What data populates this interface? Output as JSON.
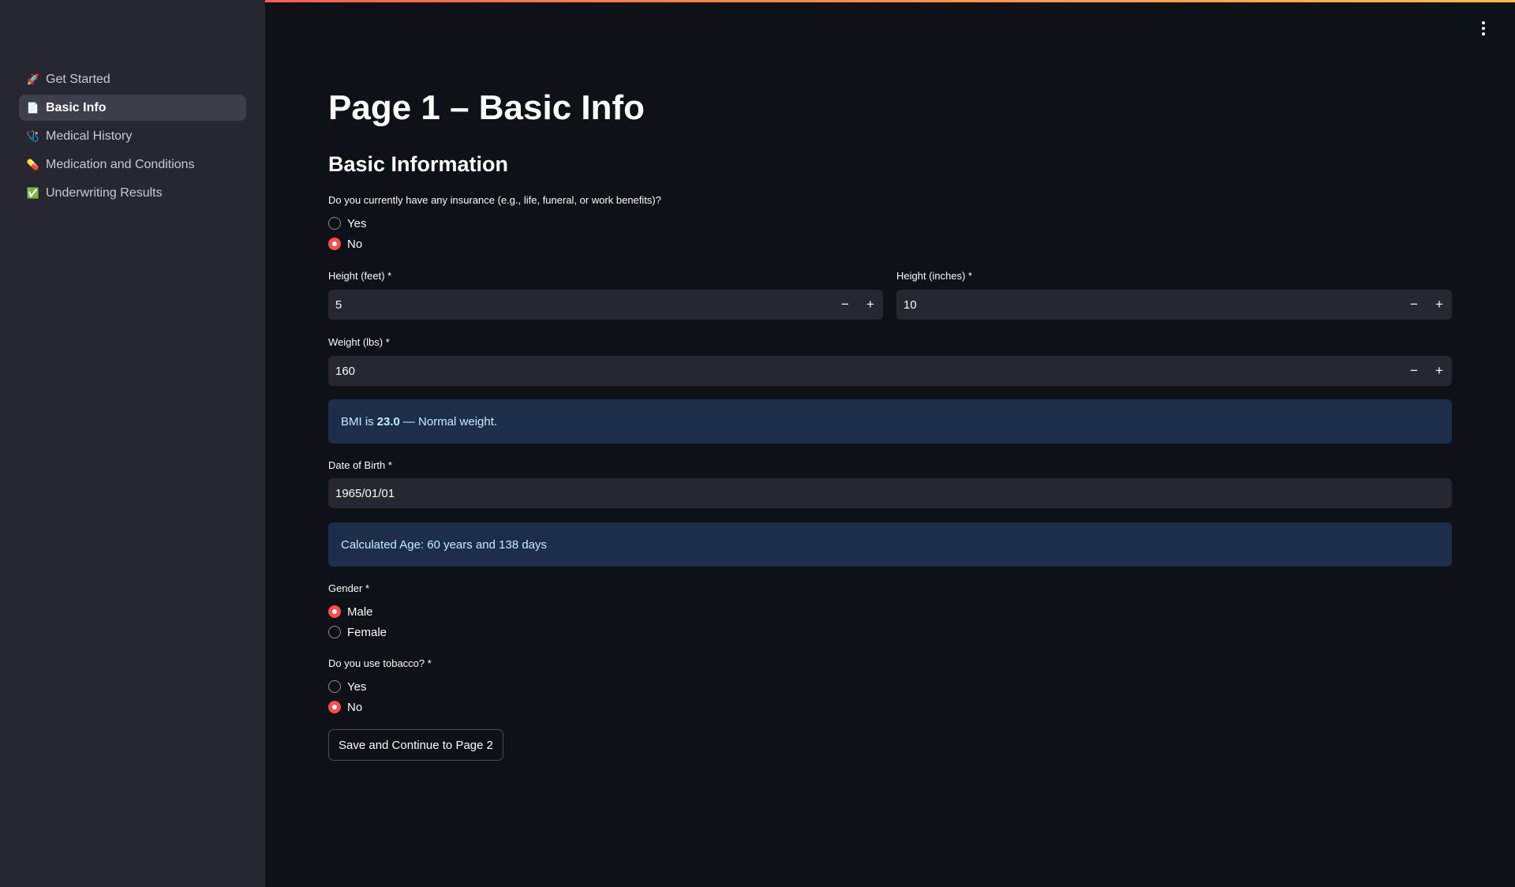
{
  "colors": {
    "accent": "#ff4b4b",
    "sidebar_bg": "#262730",
    "main_bg": "#0e1117",
    "info_bg": "#1c2e4a"
  },
  "sidebar": {
    "items": [
      {
        "icon": "rocket-icon",
        "glyph": "🚀",
        "label": "Get Started"
      },
      {
        "icon": "document-icon",
        "glyph": "📄",
        "label": "Basic Info"
      },
      {
        "icon": "stethoscope-icon",
        "glyph": "🩺",
        "label": "Medical History"
      },
      {
        "icon": "pill-icon",
        "glyph": "💊",
        "label": "Medication and Conditions"
      },
      {
        "icon": "check-box-icon",
        "glyph": "✅",
        "label": "Underwriting Results"
      }
    ],
    "active_index": 1
  },
  "header": {
    "menu_icon": "vertical-dots-icon"
  },
  "main": {
    "title": "Page 1 – Basic Info",
    "section_title": "Basic Information",
    "insurance": {
      "question": "Do you currently have any insurance (e.g., life, funeral, or work benefits)?",
      "options": [
        "Yes",
        "No"
      ],
      "selected": "No"
    },
    "height_feet": {
      "label": "Height (feet) *",
      "value": "5"
    },
    "height_inches": {
      "label": "Height (inches) *",
      "value": "10"
    },
    "weight": {
      "label": "Weight (lbs) *",
      "value": "160"
    },
    "bmi": {
      "prefix": "BMI is",
      "value": "23.0",
      "suffix": "— Normal weight."
    },
    "dob": {
      "label": "Date of Birth *",
      "value": "1965/01/01"
    },
    "age_info": "Calculated Age: 60 years and 138 days",
    "gender": {
      "label": "Gender *",
      "options": [
        "Male",
        "Female"
      ],
      "selected": "Male"
    },
    "tobacco": {
      "label": "Do you use tobacco? *",
      "options": [
        "Yes",
        "No"
      ],
      "selected": "No"
    },
    "submit_label": "Save and Continue to Page 2",
    "stepper": {
      "minus": "−",
      "plus": "+"
    }
  }
}
